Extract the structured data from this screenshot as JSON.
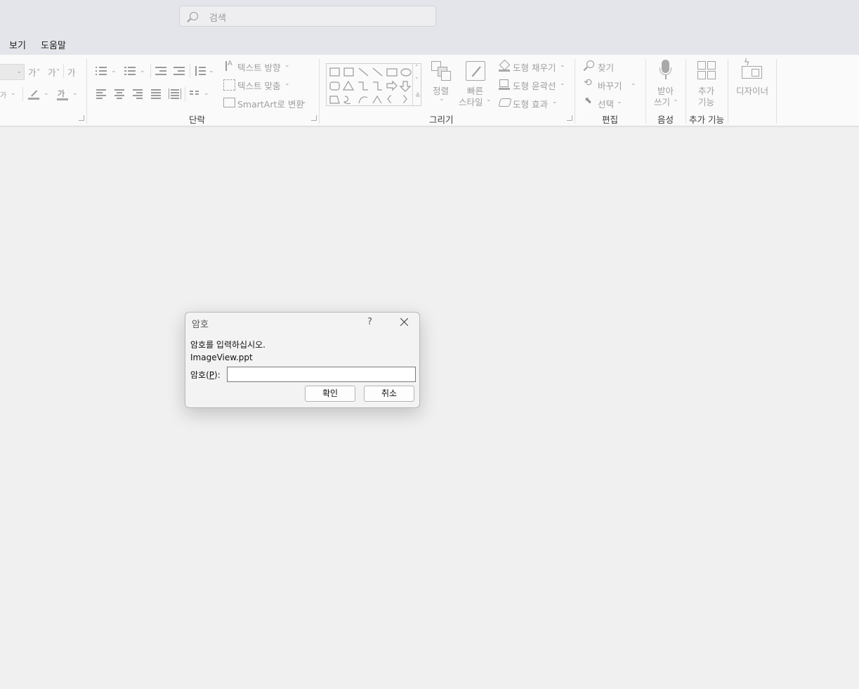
{
  "search": {
    "placeholder": "검색"
  },
  "menu": {
    "view": "보기",
    "help": "도움말"
  },
  "font_group": {
    "grow_font": "가ˆ",
    "shrink_font": "가ˇ",
    "clear_format": "가",
    "font_color_glyph": "가",
    "char_spacing": "가"
  },
  "paragraph": {
    "group_label": "단락",
    "text_direction": "텍스트 방향",
    "align_text": "텍스트 맞춤",
    "smartart": "SmartArt로 변환"
  },
  "drawing": {
    "group_label": "그리기",
    "arrange": "정렬",
    "quick_styles_line1": "빠른",
    "quick_styles_line2": "스타일",
    "shape_fill": "도형 채우기",
    "shape_outline": "도형 윤곽선",
    "shape_effects": "도형 효과"
  },
  "editing": {
    "group_label": "편집",
    "find": "찾기",
    "replace": "바꾸기",
    "select": "선택"
  },
  "voice": {
    "group_label": "음성",
    "dictate_line1": "받아",
    "dictate_line2": "쓰기"
  },
  "addins": {
    "group_label": "추가 기능",
    "button_line1": "추가",
    "button_line2": "기능"
  },
  "designer": {
    "label": "디자이너"
  },
  "dialog": {
    "title": "암호",
    "help": "?",
    "prompt": "암호를 입력하십시오.",
    "filename": "ImageView.ppt",
    "password_label_prefix": "암호(",
    "password_label_key": "P",
    "password_label_suffix": "):",
    "password_value": "",
    "ok": "확인",
    "cancel": "취소"
  }
}
